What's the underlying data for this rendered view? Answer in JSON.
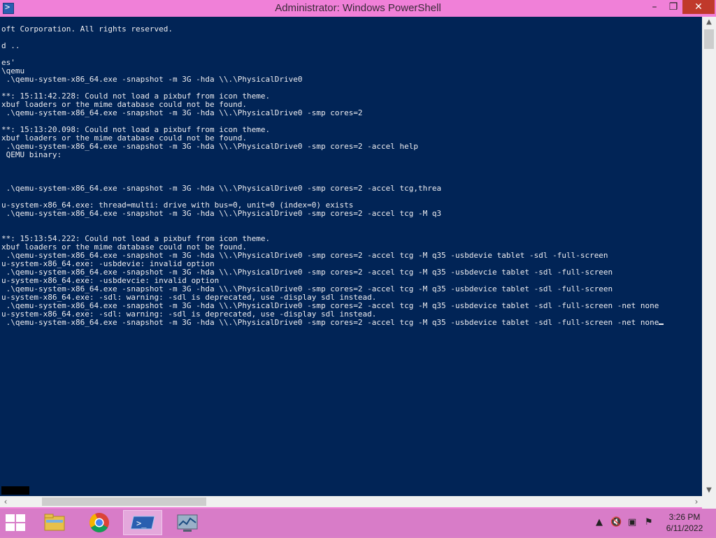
{
  "window": {
    "title": "Administrator: Windows PowerShell",
    "min_glyph": "–",
    "max_glyph": "❐",
    "close_glyph": "✕"
  },
  "console": {
    "lines": [
      "oft Corporation. All rights reserved.",
      "",
      "d ..",
      "",
      "es'",
      "\\qemu",
      " .\\qemu-system-x86_64.exe -snapshot -m 3G -hda \\\\.\\PhysicalDrive0",
      "",
      "**: 15:11:42.228: Could not load a pixbuf from icon theme.",
      "xbuf loaders or the mime database could not be found.",
      " .\\qemu-system-x86_64.exe -snapshot -m 3G -hda \\\\.\\PhysicalDrive0 -smp cores=2",
      "",
      "**: 15:13:20.098: Could not load a pixbuf from icon theme.",
      "xbuf loaders or the mime database could not be found.",
      " .\\qemu-system-x86_64.exe -snapshot -m 3G -hda \\\\.\\PhysicalDrive0 -smp cores=2 -accel help",
      " QEMU binary:",
      "",
      "",
      "",
      " .\\qemu-system-x86_64.exe -snapshot -m 3G -hda \\\\.\\PhysicalDrive0 -smp cores=2 -accel tcg,threa",
      "",
      "u-system-x86_64.exe: thread=multi: drive with bus=0, unit=0 (index=0) exists",
      " .\\qemu-system-x86_64.exe -snapshot -m 3G -hda \\\\.\\PhysicalDrive0 -smp cores=2 -accel tcg -M q3",
      "",
      "",
      "**: 15:13:54.222: Could not load a pixbuf from icon theme.",
      "xbuf loaders or the mime database could not be found.",
      " .\\qemu-system-x86_64.exe -snapshot -m 3G -hda \\\\.\\PhysicalDrive0 -smp cores=2 -accel tcg -M q35 -usbdevie tablet -sdl -full-screen",
      "u-system-x86_64.exe: -usbdevie: invalid option",
      " .\\qemu-system-x86_64.exe -snapshot -m 3G -hda \\\\.\\PhysicalDrive0 -smp cores=2 -accel tcg -M q35 -usbdevcie tablet -sdl -full-screen",
      "u-system-x86_64.exe: -usbdevcie: invalid option",
      " .\\qemu-system-x86_64.exe -snapshot -m 3G -hda \\\\.\\PhysicalDrive0 -smp cores=2 -accel tcg -M q35 -usbdevice tablet -sdl -full-screen",
      "u-system-x86_64.exe: -sdl: warning: -sdl is deprecated, use -display sdl instead.",
      " .\\qemu-system-x86_64.exe -snapshot -m 3G -hda \\\\.\\PhysicalDrive0 -smp cores=2 -accel tcg -M q35 -usbdevice tablet -sdl -full-screen -net none",
      "u-system-x86_64.exe: -sdl: warning: -sdl is deprecated, use -display sdl instead.",
      " .\\qemu-system-x86_64.exe -snapshot -m 3G -hda \\\\.\\PhysicalDrive0 -smp cores=2 -accel tcg -M q35 -usbdevice tablet -sdl -full-screen -net none"
    ]
  },
  "taskbar": {
    "apps": [
      {
        "name": "file-explorer",
        "active": false
      },
      {
        "name": "chrome",
        "active": false
      },
      {
        "name": "powershell",
        "active": true
      },
      {
        "name": "resource-monitor",
        "active": false
      }
    ],
    "tray": {
      "chevron": "▲",
      "volume": "🔇",
      "network": "▣",
      "flag": "⚑"
    },
    "time": "3:26 PM",
    "date": "6/11/2022"
  },
  "colors": {
    "console_bg": "#012456",
    "console_fg": "#eeedf0",
    "titlebar": "#f080d8",
    "taskbar": "#d87cc8"
  }
}
